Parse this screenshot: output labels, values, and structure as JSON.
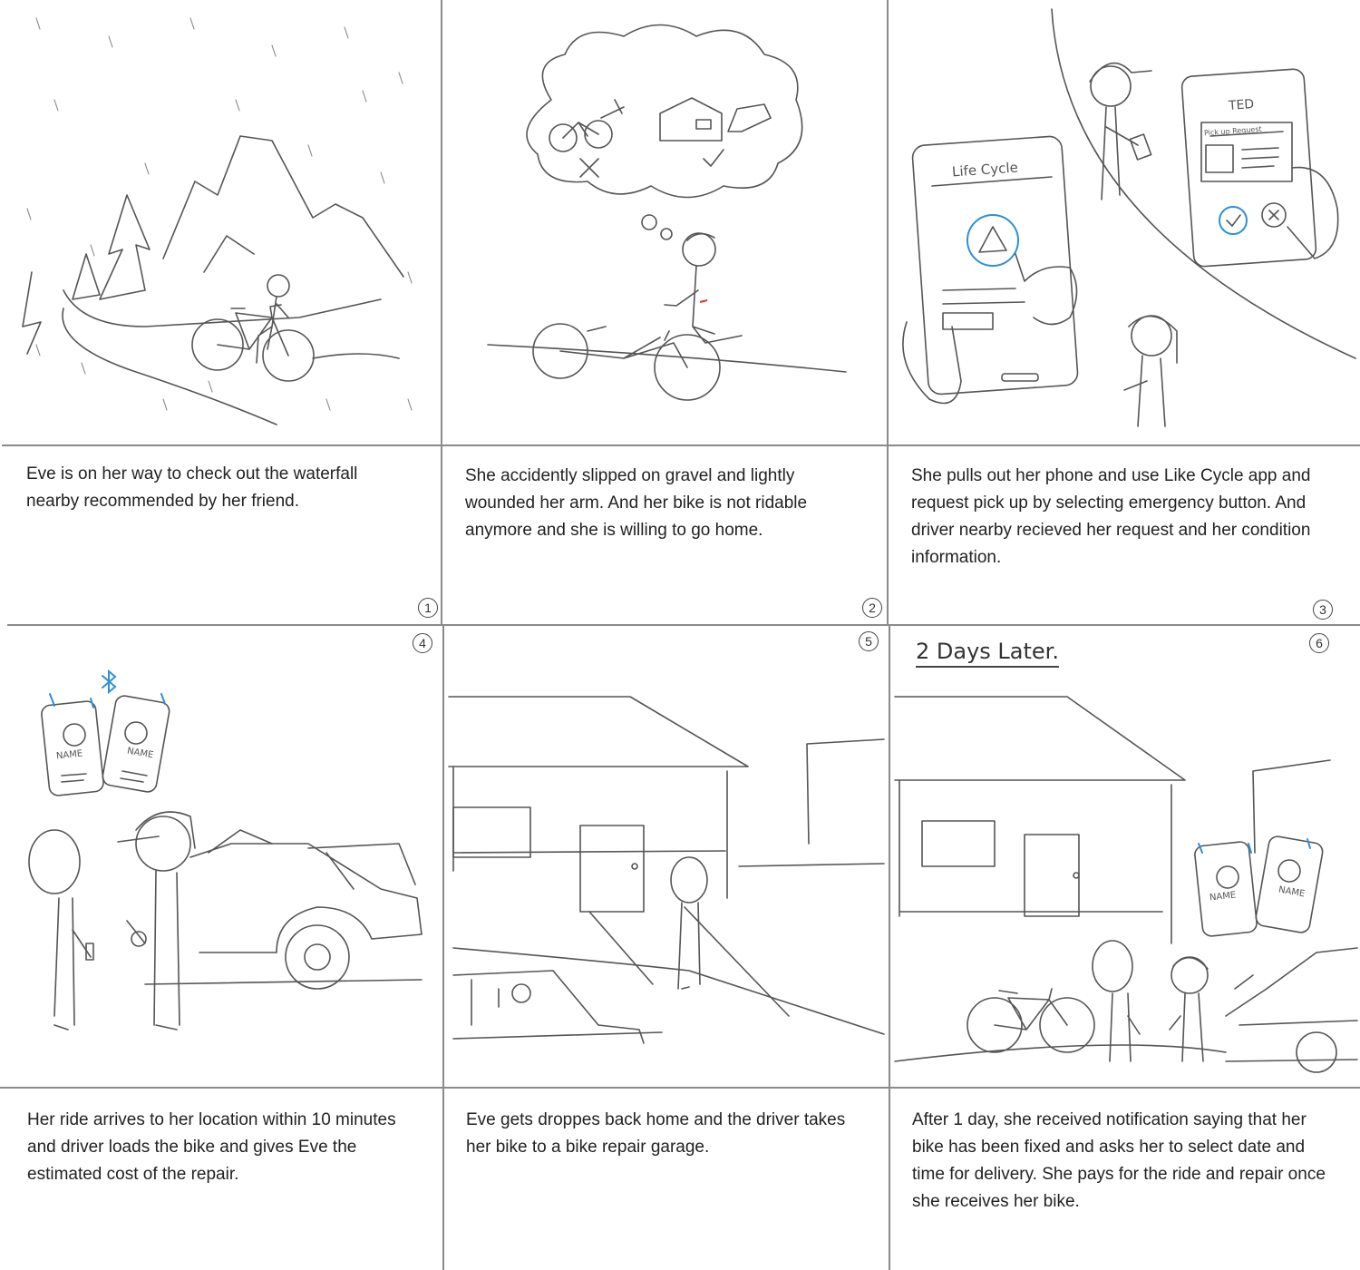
{
  "panels": [
    {
      "number": "1",
      "caption": "Eve is on her way to check out the waterfall nearby recommended by her friend."
    },
    {
      "number": "2",
      "caption": "She accidently slipped on gravel and lightly wounded her arm. And her bike is not ridable anymore and she is willing to go home."
    },
    {
      "number": "3",
      "caption": "She pulls out her phone and use Like Cycle app and request pick up by selecting emergency button. And driver nearby recieved her request and her condition information.",
      "phone_app_title": "Life Cycle",
      "driver_phone_name": "TED",
      "driver_phone_header": "Pick up Request"
    },
    {
      "number": "4",
      "caption": "Her ride arrives to her location within 10 minutes and driver loads the bike and gives Eve the estimated cost of the repair.",
      "phone_label_left": "NAME",
      "phone_label_right": "NAME"
    },
    {
      "number": "5",
      "caption": "Eve gets droppes back home and the driver takes her bike to a bike repair garage."
    },
    {
      "number": "6",
      "caption": "After 1 day, she received notification saying that her bike has been fixed and asks her to select date and time for delivery. She pays for the ride and repair once she receives her bike.",
      "handwritten_note": "2 Days Later.",
      "phone_label_left": "NAME",
      "phone_label_right": "NAME"
    }
  ],
  "colors": {
    "ink": "#555555",
    "grid": "#8a8a8a",
    "accent_blue": "#2e8fd8",
    "accent_red": "#dd3333"
  }
}
